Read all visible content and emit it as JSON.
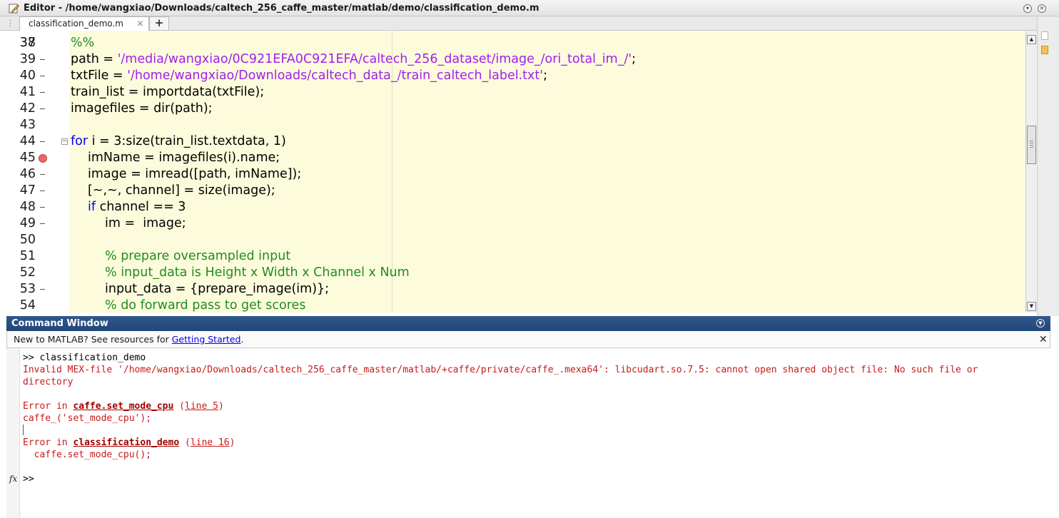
{
  "window": {
    "title": "Editor - /home/wangxiao/Downloads/caltech_256_caffe_master/matlab/demo/classification_demo.m",
    "icons": {
      "editor": "edit-pencil-icon",
      "menu": "chevron-down-circle-icon",
      "close": "close-circle-icon"
    }
  },
  "tabs": {
    "active_label": "classification_demo.m",
    "close_glyph": "×",
    "new_tab_glyph": "+"
  },
  "editor": {
    "partial_top_line_number": "37",
    "lines": [
      {
        "number": "38",
        "dash": false,
        "breakpoint": false,
        "indent": 0,
        "segments": [
          {
            "t": "%%",
            "c": "cmt"
          }
        ]
      },
      {
        "number": "39",
        "dash": true,
        "breakpoint": false,
        "indent": 0,
        "segments": [
          {
            "t": "path = ",
            "c": "plain"
          },
          {
            "t": "'/media/wangxiao/0C921EFA0C921EFA/caltech_256_dataset/image_/ori_total_im_/'",
            "c": "str"
          },
          {
            "t": ";",
            "c": "plain"
          }
        ]
      },
      {
        "number": "40",
        "dash": true,
        "breakpoint": false,
        "indent": 0,
        "segments": [
          {
            "t": "txtFile = ",
            "c": "plain"
          },
          {
            "t": "'/home/wangxiao/Downloads/caltech_data_/train_caltech_label.txt'",
            "c": "str"
          },
          {
            "t": ";",
            "c": "plain"
          }
        ]
      },
      {
        "number": "41",
        "dash": true,
        "breakpoint": false,
        "indent": 0,
        "segments": [
          {
            "t": "train_list = importdata(txtFile);",
            "c": "plain"
          }
        ]
      },
      {
        "number": "42",
        "dash": true,
        "breakpoint": false,
        "indent": 0,
        "segments": [
          {
            "t": "imagefiles = dir(path);",
            "c": "plain"
          }
        ]
      },
      {
        "number": "43",
        "dash": false,
        "breakpoint": false,
        "indent": 0,
        "segments": []
      },
      {
        "number": "44",
        "dash": true,
        "breakpoint": false,
        "fold": true,
        "indent": 0,
        "segments": [
          {
            "t": "for",
            "c": "kw"
          },
          {
            "t": " i = 3:size(train_list.textdata, 1)",
            "c": "plain"
          }
        ]
      },
      {
        "number": "45",
        "dash": false,
        "breakpoint": true,
        "indent": 1,
        "segments": [
          {
            "t": "imName = imagefiles(i).name;",
            "c": "plain"
          }
        ]
      },
      {
        "number": "46",
        "dash": true,
        "breakpoint": false,
        "indent": 1,
        "segments": [
          {
            "t": "image = imread([path, imName]);",
            "c": "plain"
          }
        ]
      },
      {
        "number": "47",
        "dash": true,
        "breakpoint": false,
        "indent": 1,
        "segments": [
          {
            "t": "[~,~, channel] = size(image);",
            "c": "plain"
          }
        ]
      },
      {
        "number": "48",
        "dash": true,
        "breakpoint": false,
        "indent": 1,
        "segments": [
          {
            "t": "if",
            "c": "kw"
          },
          {
            "t": " channel == 3",
            "c": "plain"
          }
        ]
      },
      {
        "number": "49",
        "dash": true,
        "breakpoint": false,
        "indent": 2,
        "segments": [
          {
            "t": "im =  image;",
            "c": "plain"
          }
        ]
      },
      {
        "number": "50",
        "dash": false,
        "breakpoint": false,
        "indent": 0,
        "segments": []
      },
      {
        "number": "51",
        "dash": false,
        "breakpoint": false,
        "indent": 2,
        "segments": [
          {
            "t": "% prepare oversampled input",
            "c": "cmt"
          }
        ]
      },
      {
        "number": "52",
        "dash": false,
        "breakpoint": false,
        "indent": 2,
        "segments": [
          {
            "t": "% input_data is Height x Width x Channel x Num",
            "c": "cmt"
          }
        ]
      },
      {
        "number": "53",
        "dash": true,
        "breakpoint": false,
        "indent": 2,
        "segments": [
          {
            "t": "input_data = {prepare_image(im)};",
            "c": "plain"
          }
        ]
      },
      {
        "number": "54",
        "dash": false,
        "breakpoint": false,
        "indent": 2,
        "segments": [
          {
            "t": "% do forward pass to get scores",
            "c": "cmt"
          }
        ]
      }
    ],
    "scroll_up_glyph": "▲",
    "scroll_down_glyph": "▼"
  },
  "command_window": {
    "title": "Command Window",
    "menu_glyph": "▼",
    "info_prefix": "New to MATLAB? See resources for ",
    "info_link": "Getting Started",
    "info_suffix": ".",
    "info_close_glyph": "✕",
    "prompt_command": ">> classification_demo",
    "error_mex_line1": "Invalid MEX-file '/home/wangxiao/Downloads/caltech_256_caffe_master/matlab/+caffe/private/caffe_.mexa64': libcudart.so.7.5: cannot open shared object file: No such file or",
    "error_mex_line2": "directory",
    "error1_prefix": "Error in ",
    "error1_function": "caffe.set_mode_cpu",
    "error1_line_open": " (",
    "error1_line_link": "line 5",
    "error1_line_close": ")",
    "error1_code": "caffe_('set_mode_cpu');",
    "error2_prefix": "Error in ",
    "error2_function": "classification_demo",
    "error2_line_open": " (",
    "error2_line_link": "line 16",
    "error2_line_close": ")",
    "error2_code": "  caffe.set_mode_cpu();",
    "fx_glyph": "fx",
    "prompt": ">>"
  }
}
